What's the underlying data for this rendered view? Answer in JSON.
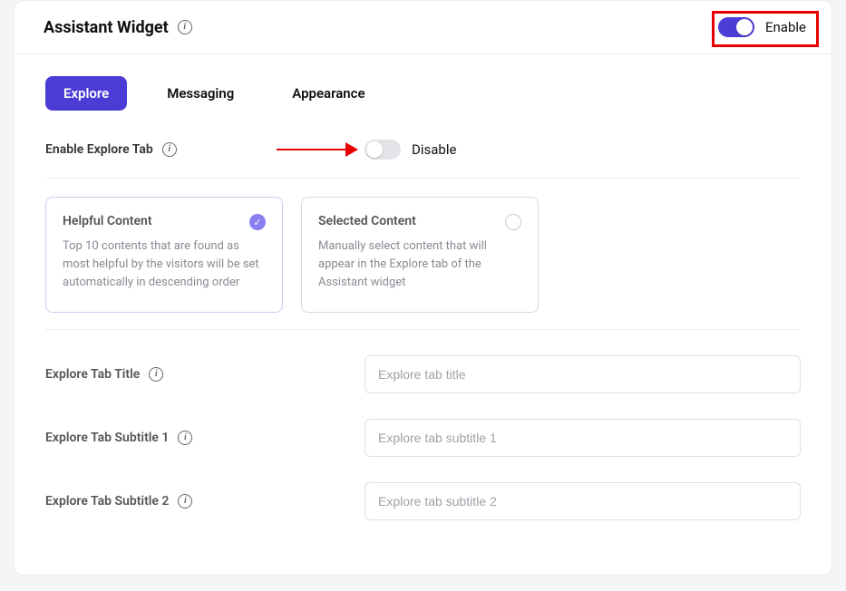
{
  "header": {
    "title": "Assistant Widget",
    "toggle_label": "Enable",
    "toggle_on": true
  },
  "tabs": [
    {
      "label": "Explore",
      "active": true
    },
    {
      "label": "Messaging",
      "active": false
    },
    {
      "label": "Appearance",
      "active": false
    }
  ],
  "enable_explore": {
    "label": "Enable Explore Tab",
    "toggle_label": "Disable",
    "toggle_on": false
  },
  "options": [
    {
      "title": "Helpful Content",
      "desc": "Top 10 contents that are found as most helpful by the visitors will be set automatically in descending order",
      "selected": true
    },
    {
      "title": "Selected Content",
      "desc": "Manually select content that will appear in the Explore tab of the Assistant widget",
      "selected": false
    }
  ],
  "fields": [
    {
      "label": "Explore Tab Title",
      "placeholder": "Explore tab title"
    },
    {
      "label": "Explore Tab Subtitle 1",
      "placeholder": "Explore tab subtitle 1"
    },
    {
      "label": "Explore Tab Subtitle 2",
      "placeholder": "Explore tab subtitle 2"
    }
  ]
}
